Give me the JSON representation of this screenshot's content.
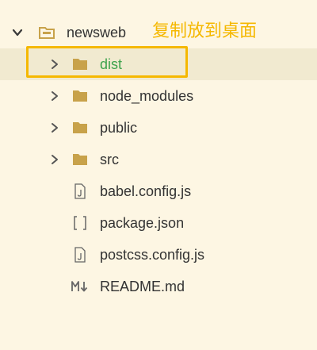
{
  "explorer": {
    "root": {
      "label": "newsweb",
      "icon": "folder-open-icon",
      "chevron": "chevron-down-icon"
    },
    "items": [
      {
        "label": "dist",
        "type": "folder",
        "icon": "folder-icon",
        "chevron": "chevron-right-icon",
        "selected": true
      },
      {
        "label": "node_modules",
        "type": "folder",
        "icon": "folder-icon",
        "chevron": "chevron-right-icon"
      },
      {
        "label": "public",
        "type": "folder",
        "icon": "folder-icon",
        "chevron": "chevron-right-icon"
      },
      {
        "label": "src",
        "type": "folder",
        "icon": "folder-icon",
        "chevron": "chevron-right-icon"
      },
      {
        "label": "babel.config.js",
        "type": "file",
        "icon": "js-file-icon"
      },
      {
        "label": "package.json",
        "type": "file",
        "icon": "json-file-icon"
      },
      {
        "label": "postcss.config.js",
        "type": "file",
        "icon": "js-file-icon"
      },
      {
        "label": "README.md",
        "type": "file",
        "icon": "markdown-file-icon"
      }
    ]
  },
  "annotation": {
    "text": "复制放到桌面"
  },
  "colors": {
    "background": "#fdf6e3",
    "selected_row": "#f1ead0",
    "annotation": "#f5b800",
    "folder": "#c8a24a",
    "selected_label": "#3fa34d"
  }
}
